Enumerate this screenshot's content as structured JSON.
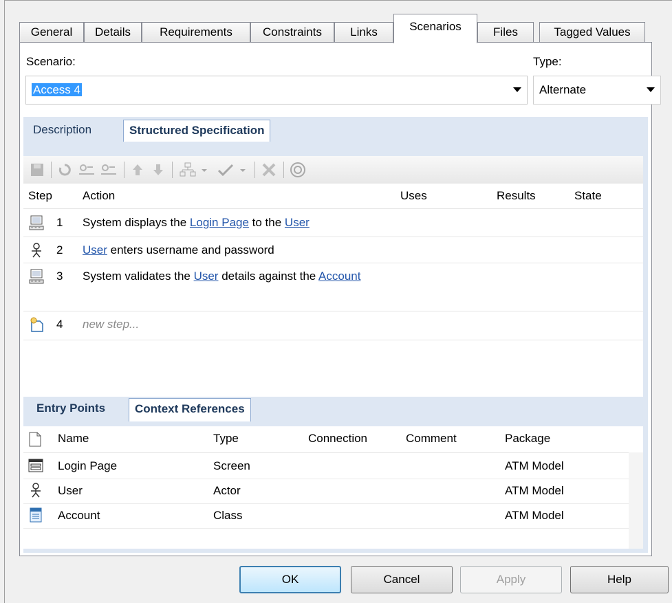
{
  "tabs": [
    "General",
    "Details",
    "Requirements",
    "Constraints",
    "Links",
    "Scenarios",
    "Files",
    "Tagged Values"
  ],
  "active_tab": "Scenarios",
  "scenario": {
    "label": "Scenario:",
    "value": "Access 4"
  },
  "type": {
    "label": "Type:",
    "value": "Alternate"
  },
  "subtabs": {
    "description": "Description",
    "structured": "Structured Specification"
  },
  "grid": {
    "headers": {
      "step": "Step",
      "action": "Action",
      "uses": "Uses",
      "results": "Results",
      "state": "State"
    },
    "rows": [
      {
        "num": "1",
        "icon": "system-icon",
        "parts": [
          [
            "System displays the ",
            false
          ],
          [
            "Login Page",
            true
          ],
          [
            " to the ",
            false
          ],
          [
            "User",
            true
          ]
        ]
      },
      {
        "num": "2",
        "icon": "actor-icon",
        "parts": [
          [
            "User",
            true
          ],
          [
            " enters username and password",
            false
          ]
        ]
      },
      {
        "num": "3",
        "icon": "system-icon",
        "parts": [
          [
            "System validates the ",
            false
          ],
          [
            "User",
            true
          ],
          [
            " details against the ",
            false
          ],
          [
            "Account",
            true
          ]
        ]
      },
      {
        "num": "4",
        "icon": "new-step-icon",
        "placeholder": "new step..."
      }
    ]
  },
  "bottom_tabs": {
    "entry": "Entry Points",
    "context": "Context References"
  },
  "refs": {
    "headers": {
      "name": "Name",
      "type": "Type",
      "connection": "Connection",
      "comment": "Comment",
      "package": "Package"
    },
    "rows": [
      {
        "icon": "screen-icon",
        "name": "Login Page",
        "type": "Screen",
        "package": "ATM Model"
      },
      {
        "icon": "actor-icon",
        "name": "User",
        "type": "Actor",
        "package": "ATM Model"
      },
      {
        "icon": "class-icon",
        "name": "Account",
        "type": "Class",
        "package": "ATM Model"
      }
    ]
  },
  "buttons": {
    "ok": "OK",
    "cancel": "Cancel",
    "apply": "Apply",
    "help": "Help"
  }
}
